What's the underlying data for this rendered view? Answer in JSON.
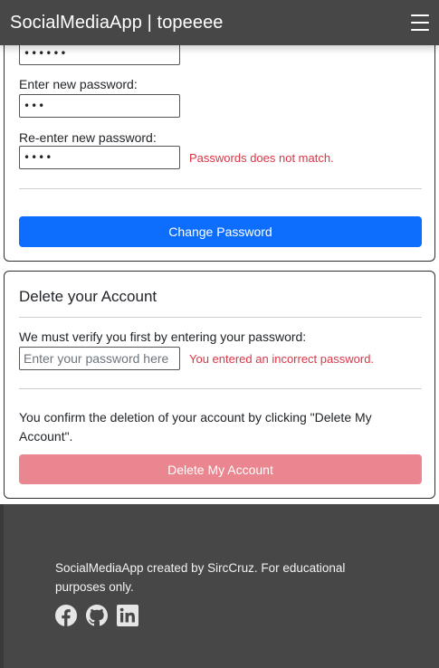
{
  "navbar": {
    "brand": "SocialMediaApp | topeeee",
    "menu_icon": "hamburger-menu-icon"
  },
  "change_password": {
    "current_password_value": "••••••",
    "new_password_label": "Enter new password:",
    "new_password_value": "•••",
    "reenter_label": "Re-enter new password:",
    "reenter_value": "••••",
    "mismatch_error": "Passwords does not match.",
    "button_label": "Change Password"
  },
  "delete_account": {
    "title": "Delete your Account",
    "verify_label": "We must verify you first by entering your password:",
    "password_placeholder": "Enter your password here",
    "incorrect_error": "You entered an incorrect password.",
    "confirm_text": "You confirm the deletion of your account by clicking \"Delete My Account\".",
    "button_label": "Delete My Account"
  },
  "footer": {
    "text": "SocialMediaApp created by SircCruz. For educational purposes only.",
    "icons": [
      "facebook-icon",
      "github-icon",
      "linkedin-icon"
    ]
  },
  "colors": {
    "navbar_bg": "#474747",
    "primary_button": "#0d6efd",
    "danger_button_disabled": "#ea868f",
    "error_text": "#dc3545"
  }
}
